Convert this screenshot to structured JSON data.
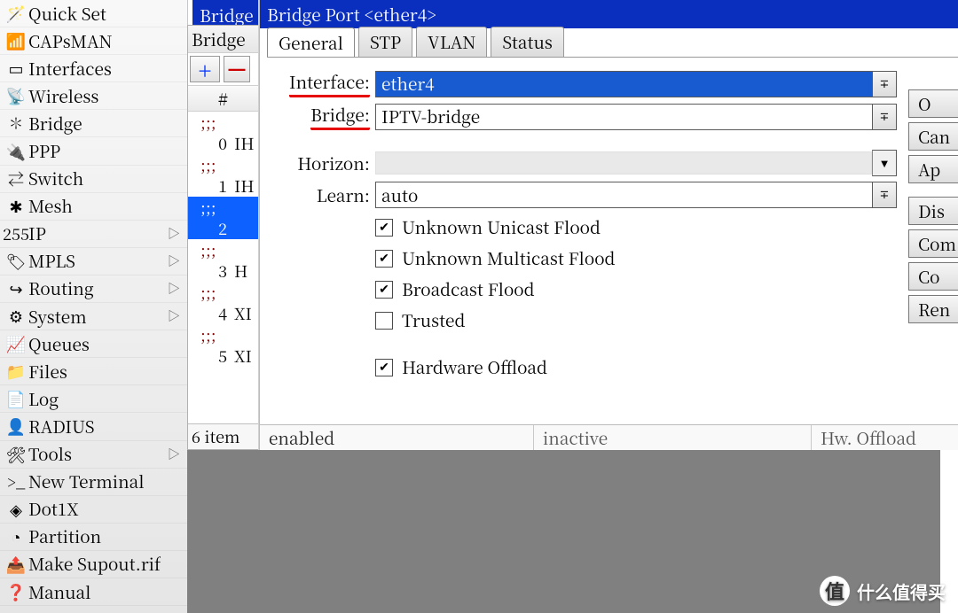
{
  "sidebar": {
    "items": [
      {
        "icon": "🪄",
        "label": "Quick Set",
        "arrow": false
      },
      {
        "icon": "📶",
        "label": "CAPsMAN",
        "arrow": false
      },
      {
        "icon": "▭",
        "label": "Interfaces",
        "arrow": false
      },
      {
        "icon": "📡",
        "label": "Wireless",
        "arrow": false
      },
      {
        "icon": "✽",
        "label": "Bridge",
        "arrow": false
      },
      {
        "icon": "🔌",
        "label": "PPP",
        "arrow": false
      },
      {
        "icon": "⇄",
        "label": "Switch",
        "arrow": false
      },
      {
        "icon": "✱",
        "label": "Mesh",
        "arrow": false
      },
      {
        "icon": "255",
        "label": "IP",
        "arrow": true
      },
      {
        "icon": "🏷",
        "label": "MPLS",
        "arrow": true
      },
      {
        "icon": "↪",
        "label": "Routing",
        "arrow": true
      },
      {
        "icon": "⚙",
        "label": "System",
        "arrow": true
      },
      {
        "icon": "📈",
        "label": "Queues",
        "arrow": false
      },
      {
        "icon": "📁",
        "label": "Files",
        "arrow": false
      },
      {
        "icon": "📄",
        "label": "Log",
        "arrow": false
      },
      {
        "icon": "👤",
        "label": "RADIUS",
        "arrow": false
      },
      {
        "icon": "🛠",
        "label": "Tools",
        "arrow": true
      },
      {
        "icon": ">_",
        "label": "New Terminal",
        "arrow": false
      },
      {
        "icon": "◈",
        "label": "Dot1X",
        "arrow": false
      },
      {
        "icon": "◔",
        "label": "Partition",
        "arrow": false
      },
      {
        "icon": "📤",
        "label": "Make Supout.rif",
        "arrow": false
      },
      {
        "icon": "❓",
        "label": "Manual",
        "arrow": false
      }
    ]
  },
  "bg_window": {
    "title": "Bridge",
    "subtitle": "Bridge",
    "col_header": "#",
    "rows": [
      {
        "sep": ";;;",
        "num": "",
        "tag": ""
      },
      {
        "sep": "",
        "num": "0",
        "tag": "IH"
      },
      {
        "sep": ";;;",
        "num": "",
        "tag": ""
      },
      {
        "sep": "",
        "num": "1",
        "tag": "IH"
      },
      {
        "sep": ";;;",
        "num": "",
        "tag": "",
        "selected": true
      },
      {
        "sep": "",
        "num": "2",
        "tag": "",
        "selected": true
      },
      {
        "sep": ";;;",
        "num": "",
        "tag": ""
      },
      {
        "sep": "",
        "num": "3",
        "tag": "H"
      },
      {
        "sep": ";;;",
        "num": "",
        "tag": ""
      },
      {
        "sep": "",
        "num": "4",
        "tag": "XI"
      },
      {
        "sep": ";;;",
        "num": "",
        "tag": ""
      },
      {
        "sep": "",
        "num": "5",
        "tag": "XI"
      }
    ],
    "footer": "6 item"
  },
  "dialog": {
    "title": "Bridge Port <ether4>",
    "tabs": [
      "General",
      "STP",
      "VLAN",
      "Status"
    ],
    "active_tab": 0,
    "labels": {
      "interface": "Interface:",
      "bridge": "Bridge:",
      "horizon": "Horizon:",
      "learn": "Learn:"
    },
    "values": {
      "interface": "ether4",
      "bridge": "IPTV-bridge",
      "horizon": "",
      "learn": "auto"
    },
    "checkboxes": [
      {
        "label": "Unknown Unicast Flood",
        "checked": true
      },
      {
        "label": "Unknown Multicast Flood",
        "checked": true
      },
      {
        "label": "Broadcast Flood",
        "checked": true
      },
      {
        "label": "Trusted",
        "checked": false
      },
      {
        "label": "Hardware Offload",
        "checked": true
      }
    ],
    "buttons": [
      "O",
      "Can",
      "Ap",
      "Dis",
      "Com",
      "Co",
      "Ren"
    ],
    "status": {
      "enabled": "enabled",
      "inactive": "inactive",
      "hw": "Hw. Offload"
    }
  },
  "watermark": {
    "text": "什么值得买",
    "badge": "值"
  }
}
